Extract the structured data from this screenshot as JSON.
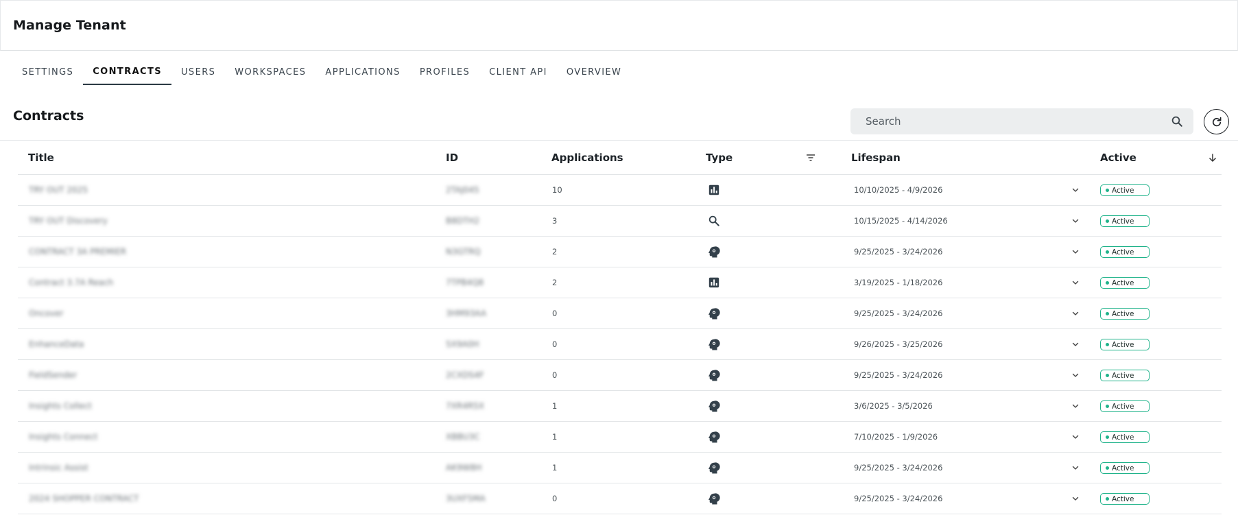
{
  "header": {
    "title": "Manage Tenant"
  },
  "tabs": [
    {
      "label": "SETTINGS",
      "active": false
    },
    {
      "label": "CONTRACTS",
      "active": true
    },
    {
      "label": "USERS",
      "active": false
    },
    {
      "label": "WORKSPACES",
      "active": false
    },
    {
      "label": "APPLICATIONS",
      "active": false
    },
    {
      "label": "PROFILES",
      "active": false
    },
    {
      "label": "CLIENT API",
      "active": false
    },
    {
      "label": "OVERVIEW",
      "active": false
    }
  ],
  "section": {
    "title": "Contracts"
  },
  "search": {
    "placeholder": "Search",
    "value": ""
  },
  "table": {
    "columns": {
      "title": "Title",
      "id": "ID",
      "applications": "Applications",
      "type": "Type",
      "lifespan": "Lifespan",
      "active": "Active"
    },
    "rows": [
      {
        "title": "TRY OUT 2025",
        "id": "2TAJ045",
        "applications": "10",
        "type": "chart-icon",
        "lifespan": "10/10/2025 - 4/9/2026",
        "status": "Active"
      },
      {
        "title": "TRY OUT Discovery",
        "id": "B8DTH2",
        "applications": "3",
        "type": "search-icon",
        "lifespan": "10/15/2025 - 4/14/2026",
        "status": "Active"
      },
      {
        "title": "CONTRACT 3A PREMIER",
        "id": "N3GTRQ",
        "applications": "2",
        "type": "ai-head-icon",
        "lifespan": "9/25/2025 - 3/24/2026",
        "status": "Active"
      },
      {
        "title": "Contract 3.7A Reach",
        "id": "7TPB4Q8",
        "applications": "2",
        "type": "chart-icon",
        "lifespan": "3/19/2025 - 1/18/2026",
        "status": "Active"
      },
      {
        "title": "Oncover",
        "id": "3HM93AA",
        "applications": "0",
        "type": "ai-head-icon",
        "lifespan": "9/25/2025 - 3/24/2026",
        "status": "Active"
      },
      {
        "title": "EnhanceData",
        "id": "5X9A0H",
        "applications": "0",
        "type": "ai-head-icon",
        "lifespan": "9/26/2025 - 3/25/2026",
        "status": "Active"
      },
      {
        "title": "FieldSender",
        "id": "2CXDS4F",
        "applications": "0",
        "type": "ai-head-icon",
        "lifespan": "9/25/2025 - 3/24/2026",
        "status": "Active"
      },
      {
        "title": "Insights Collect",
        "id": "7XR4R5X",
        "applications": "1",
        "type": "ai-head-icon",
        "lifespan": "3/6/2025 - 3/5/2026",
        "status": "Active"
      },
      {
        "title": "Insights Connect",
        "id": "XBBU3C",
        "applications": "1",
        "type": "ai-head-icon",
        "lifespan": "7/10/2025 - 1/9/2026",
        "status": "Active"
      },
      {
        "title": "Intrinsic Assist",
        "id": "AK9W8H",
        "applications": "1",
        "type": "ai-head-icon",
        "lifespan": "9/25/2025 - 3/24/2026",
        "status": "Active"
      },
      {
        "title": "2024 SHOPPER CONTRACT",
        "id": "3UXF5MA",
        "applications": "0",
        "type": "ai-head-icon",
        "lifespan": "9/25/2025 - 3/24/2026",
        "status": "Active"
      }
    ]
  },
  "colors": {
    "accent": "#1fb38a",
    "icon": "#33404a"
  }
}
